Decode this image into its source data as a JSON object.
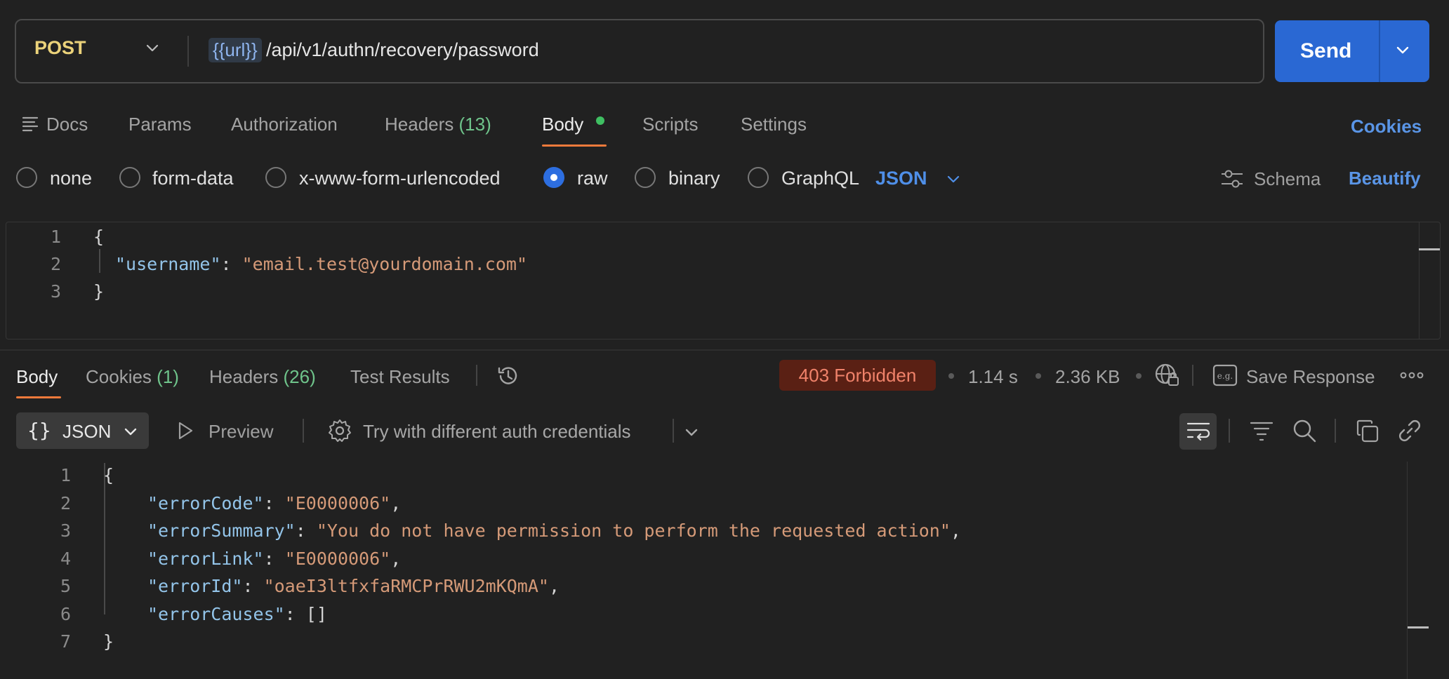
{
  "request": {
    "method": "POST",
    "url_variable": "{{url}}",
    "url_path": "/api/v1/authn/recovery/password",
    "send_label": "Send"
  },
  "request_tabs": {
    "docs": "Docs",
    "params": "Params",
    "authorization": "Authorization",
    "headers": "Headers",
    "headers_count": "(13)",
    "body": "Body",
    "scripts": "Scripts",
    "settings": "Settings",
    "cookies": "Cookies"
  },
  "body_modes": {
    "none": "none",
    "form_data": "form-data",
    "urlencoded": "x-www-form-urlencoded",
    "raw": "raw",
    "binary": "binary",
    "graphql": "GraphQL",
    "selected": "raw",
    "language": "JSON",
    "schema": "Schema",
    "beautify": "Beautify"
  },
  "request_body": {
    "line_numbers": [
      "1",
      "2",
      "3"
    ],
    "open_brace": "{",
    "key": "\"username\"",
    "colon": ": ",
    "value": "\"email.test@yourdomain.com\"",
    "close_brace": "}"
  },
  "response_tabs": {
    "body": "Body",
    "cookies": "Cookies",
    "cookies_count": "(1)",
    "headers": "Headers",
    "headers_count": "(26)",
    "test_results": "Test Results"
  },
  "response_meta": {
    "status": "403 Forbidden",
    "status_color": "#f0826a",
    "time": "1.14 s",
    "size": "2.36 KB",
    "save_response": "Save Response"
  },
  "response_toolbar": {
    "format": "JSON",
    "preview": "Preview",
    "auth_hint": "Try with different auth credentials"
  },
  "response_body": {
    "line_numbers": [
      "1",
      "2",
      "3",
      "4",
      "5",
      "6",
      "7"
    ],
    "open_brace": "{",
    "close_brace": "}",
    "fields": [
      {
        "key": "\"errorCode\"",
        "value": "\"E0000006\"",
        "trail": ","
      },
      {
        "key": "\"errorSummary\"",
        "value": "\"You do not have permission to perform the requested action\"",
        "trail": ","
      },
      {
        "key": "\"errorLink\"",
        "value": "\"E0000006\"",
        "trail": ","
      },
      {
        "key": "\"errorId\"",
        "value": "\"oaeI3ltfxfaRMCPrRWU2mKQmA\"",
        "trail": ","
      },
      {
        "key": "\"errorCauses\"",
        "value": "[]",
        "trail": ""
      }
    ]
  },
  "colors": {
    "accent_blue": "#2a68d3",
    "tab_underline": "#f07a3b",
    "count_green": "#6fc48b",
    "json_key": "#93c4e9",
    "json_string": "#d59a78"
  }
}
